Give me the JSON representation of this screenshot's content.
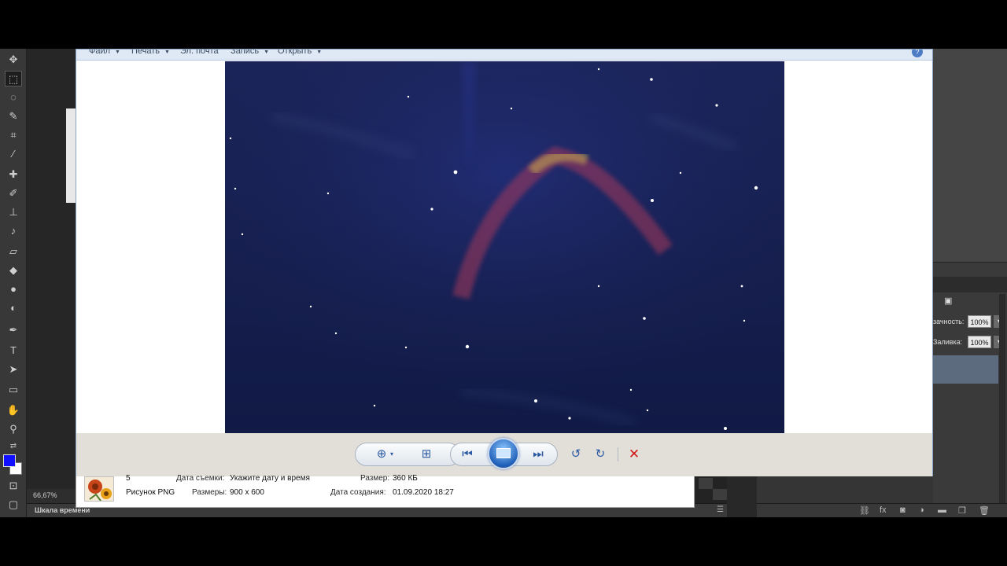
{
  "photoshop": {
    "zoom": "66,67%",
    "timeline_label": "Шкала времени",
    "opacity_label": "зачность:",
    "opacity_value": "100%",
    "fill_label": "Заливка:",
    "fill_value": "100%"
  },
  "viewer": {
    "menu": {
      "file": "Файл",
      "print": "Печать",
      "email": "Эл. почта",
      "burn": "Запись",
      "open": "Открыть"
    },
    "colors": {
      "accent": "#2b5aa3",
      "delete": "#d01818",
      "sky_top": "#1b2458",
      "sky_bottom": "#111a45"
    }
  },
  "file_info": {
    "name": "5",
    "type": "Рисунок PNG",
    "date_taken_label": "Дата съемки:",
    "date_taken_value": "Укажите дату и время",
    "dimensions_label": "Размеры:",
    "dimensions_value": "900 x 600",
    "size_label": "Размер:",
    "size_value": "360 КБ",
    "created_label": "Дата создания:",
    "created_value": "01.09.2020 18:27"
  }
}
